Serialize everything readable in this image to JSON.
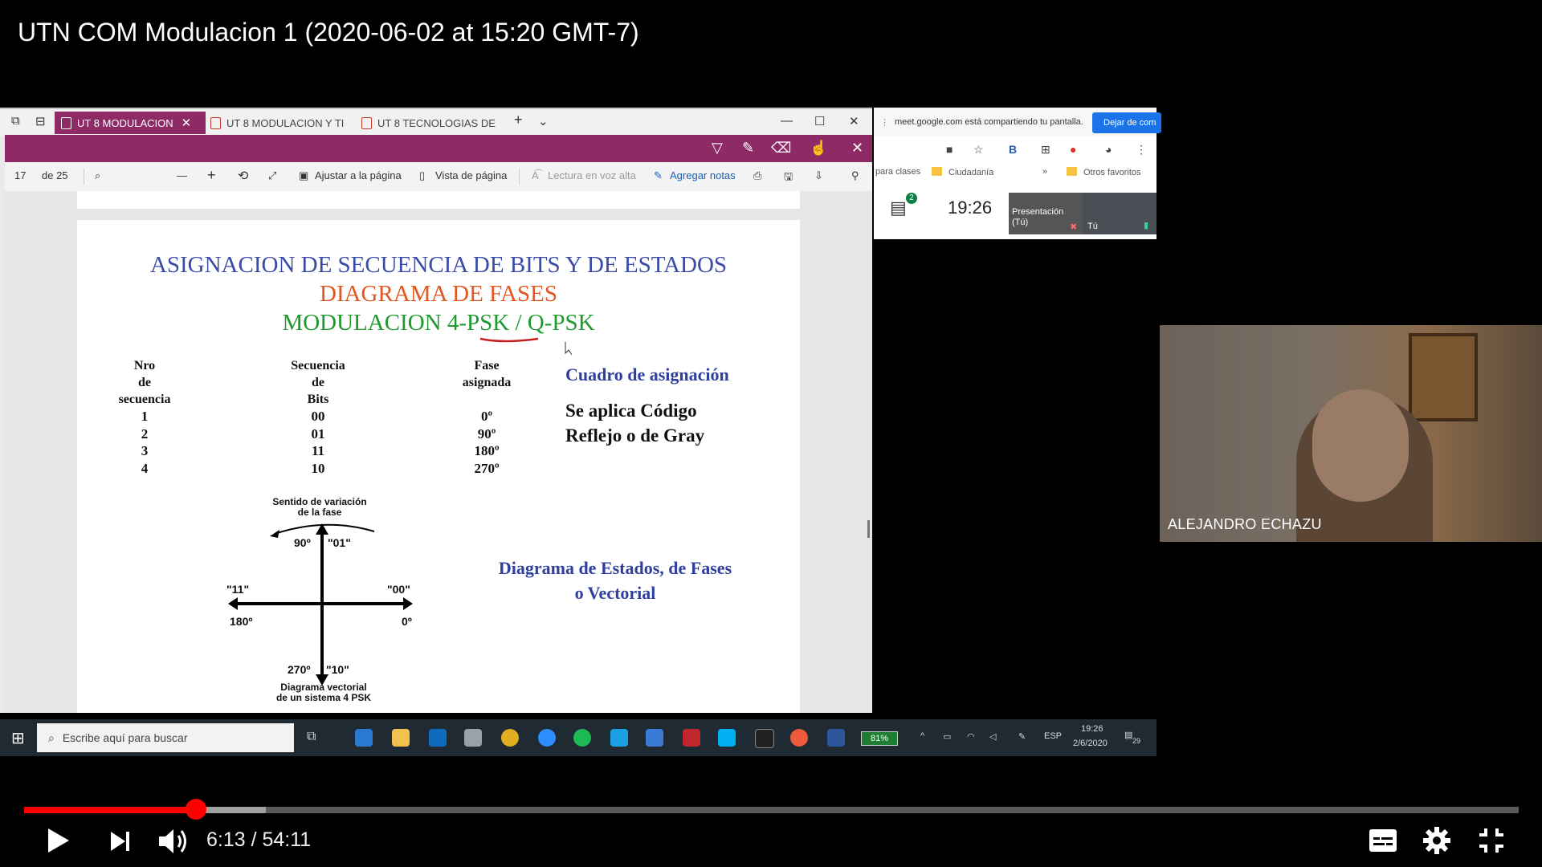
{
  "video": {
    "title": "UTN COM Modulacion 1 (2020-06-02 at 15:20 GMT-7)",
    "current_time": "6:13",
    "duration": "54:11",
    "time_display": "6:13 / 54:11",
    "progress_fraction": 0.115,
    "buffered_fraction": 0.162
  },
  "edge": {
    "tabs": [
      {
        "label": "UT 8 MODULACION",
        "active": true
      },
      {
        "label": "UT 8 MODULACION Y TI",
        "active": false
      },
      {
        "label": "UT 8 TECNOLOGIAS DE",
        "active": false
      }
    ],
    "new_tab": "+",
    "tab_list": "⌄",
    "win_minimize": "—",
    "win_maximize": "☐",
    "win_close": "✕",
    "purple_close": "✕",
    "toolbar": {
      "page_number": "17",
      "page_total": "de 25",
      "zoom_out": "—",
      "zoom_in": "+",
      "fit_page": "Ajustar a la página",
      "page_view": "Vista de página",
      "read_aloud": "Lectura en voz alta",
      "add_notes": "Agregar notas"
    }
  },
  "slide": {
    "title1": "ASIGNACION DE SECUENCIA DE BITS Y DE ESTADOS",
    "title2": "DIAGRAMA DE FASES",
    "title3": "MODULACION 4-PSK / Q-PSK",
    "headers": {
      "seq_num": "Nro\nde\nsecuencia",
      "bits": "Secuencia\nde\nBits",
      "phase": "Fase\nasignada"
    },
    "rows": [
      {
        "n": "1",
        "bits": "00",
        "phase": "0º"
      },
      {
        "n": "2",
        "bits": "01",
        "phase": "90º"
      },
      {
        "n": "3",
        "bits": "11",
        "phase": "180º"
      },
      {
        "n": "4",
        "bits": "10",
        "phase": "270º"
      }
    ],
    "assign_title": "Cuadro de asignación",
    "gray_text": "Se aplica Código\nReflejo o de Gray",
    "diagram_caption": "Diagrama de Estados, de Fases\no Vectorial",
    "vector": {
      "rotation_label": "Sentido de variación\nde la fase",
      "top_deg": "90º",
      "top_code": "\"01\"",
      "left_code": "\"11\"",
      "left_deg": "180º",
      "right_code": "\"00\"",
      "right_deg": "0º",
      "bottom_deg": "270º",
      "bottom_code": "\"10\"",
      "caption": "Diagrama vectorial\nde un sistema 4 PSK"
    }
  },
  "meet": {
    "sharing_notice": "meet.google.com está compartiendo tu pantalla.",
    "stop_button": "Dejar de com",
    "bookmarks": [
      "para clases",
      "Ciudadanía",
      "»",
      "Otros favoritos"
    ],
    "chat_badge": "2",
    "clock": "19:26",
    "presentation_label": "Presentación\n(Tú)",
    "you_label": "Tú"
  },
  "taskbar": {
    "search_placeholder": "Escribe aquí para buscar",
    "battery": "81%",
    "language": "ESP",
    "time": "19:26",
    "date": "2/6/2020",
    "notifications": "29"
  },
  "webcam": {
    "name": "ALEJANDRO ECHAZU"
  },
  "colors": {
    "accent_red": "#ff0000",
    "edge_purple": "#8e2a66",
    "slide_title_blue": "#3a4aa8",
    "slide_title_orange": "#e2561f",
    "slide_title_green": "#1f9a2f",
    "meet_blue": "#1a73e8"
  }
}
